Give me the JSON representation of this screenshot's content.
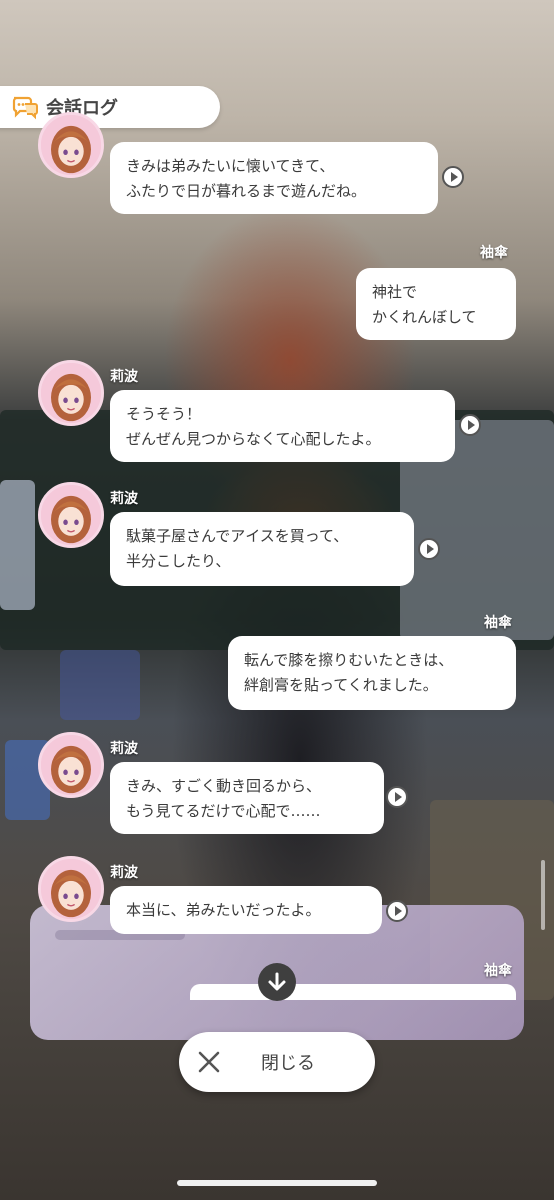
{
  "header": {
    "title": "会話ログ",
    "icon": "speech-log-icon"
  },
  "messages": [
    {
      "speaker": "",
      "text": "きみは弟みたいに懐いてきて、\nふたりで日が暮れるまで遊んだね。",
      "side": "left",
      "has_avatar": true
    },
    {
      "speaker": "袖傘",
      "text": "神社で\nかくれんぼして",
      "side": "right"
    },
    {
      "speaker": "莉波",
      "text": "そうそう！\nぜんぜん見つからなくて心配したよ。",
      "side": "left",
      "has_avatar": true
    },
    {
      "speaker": "莉波",
      "text": "駄菓子屋さんでアイスを買って、\n半分こしたり、",
      "side": "left",
      "has_avatar": true
    },
    {
      "speaker": "袖傘",
      "text": "転んで膝を擦りむいたときは、\n絆創膏を貼ってくれました。",
      "side": "right"
    },
    {
      "speaker": "莉波",
      "text": "きみ、すごく動き回るから、\nもう見てるだけで心配で……",
      "side": "left",
      "has_avatar": true
    },
    {
      "speaker": "莉波",
      "text": "本当に、弟みたいだったよ。",
      "side": "left",
      "has_avatar": true
    },
    {
      "speaker": "袖傘",
      "text": "",
      "side": "right"
    }
  ],
  "controls": {
    "scroll_down_icon": "arrow-down-icon",
    "close_label": "閉じる",
    "close_icon": "close-icon"
  },
  "colors": {
    "bubble": "#ffffff",
    "avatar_ring": "#f8d8e6",
    "text": "#3b3b3b"
  }
}
